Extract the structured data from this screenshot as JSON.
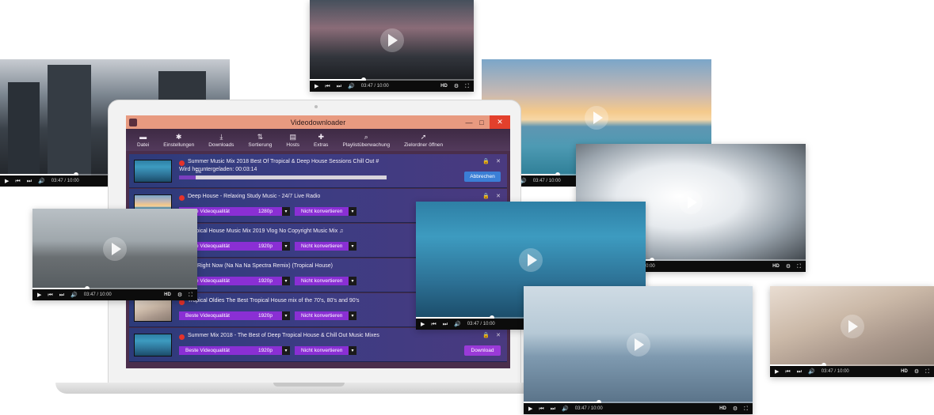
{
  "app": {
    "title": "Videodownloader",
    "window_buttons": {
      "minimize": "—",
      "maximize": "□",
      "close": "✕"
    },
    "toolbar": [
      {
        "label": "Datei",
        "icon": "folder-icon",
        "glyph": "▬"
      },
      {
        "label": "Einstellungen",
        "icon": "gear-icon",
        "glyph": "✱"
      },
      {
        "label": "Downloads",
        "icon": "download-icon",
        "glyph": "⤓"
      },
      {
        "label": "Sortierung",
        "icon": "sort-icon",
        "glyph": "⇅"
      },
      {
        "label": "Hosts",
        "icon": "hosts-icon",
        "glyph": "▤"
      },
      {
        "label": "Extras",
        "icon": "extras-icon",
        "glyph": "✚"
      },
      {
        "label": "Playlistüberwachung",
        "icon": "search-icon",
        "glyph": "⌕"
      },
      {
        "label": "Zielordner öffnen",
        "icon": "open-folder-icon",
        "glyph": "➚"
      }
    ],
    "rows": [
      {
        "title": "Summer Music Mix 2018 Best Of Tropical & Deep House Sessions Chill Out #",
        "status": "Wird heruntergeladen: 00:03:14",
        "progress_label": "8%",
        "progress": 0.08,
        "action": "Abbrechen"
      },
      {
        "title": "Deep House - Relaxing Study Music - 24/7 Live Radio",
        "quality": "Beste Videoqualität",
        "resolution": "1280p",
        "convert": "Nicht konvertieren"
      },
      {
        "title": "Tropical House Music Mix 2019 Vlog No Copyright Music Mix ♫",
        "quality": "Beste Videoqualität",
        "resolution": "1920p",
        "convert": "Nicht konvertieren"
      },
      {
        "title": "... - Right Now (Na Na Na Spectra Remix) (Tropical House)",
        "quality": "Beste Videoqualität",
        "resolution": "1920p",
        "convert": "Nicht konvertieren"
      },
      {
        "title": "Tropical Oldies The Best Tropical House mix of the 70's, 80's and 90's",
        "quality": "Beste Videoqualität",
        "resolution": "1920p",
        "convert": "Nicht konvertieren"
      },
      {
        "title": "Summer Mix 2018 - The Best of Deep Tropical House & Chill Out Music Mixes",
        "quality": "Beste Videoqualität",
        "resolution": "1920p",
        "convert": "Nicht konvertieren",
        "action": "Download"
      }
    ],
    "row_controls": {
      "lock": "🔒",
      "close": "✕"
    }
  },
  "player": {
    "time": "03:47 / 10:00",
    "hd": "HD",
    "controls": {
      "play": "▶",
      "prev": "⏮",
      "next": "⏭",
      "volume": "🔊",
      "settings": "⚙",
      "fullscreen": "⛶"
    }
  },
  "colors": {
    "accent": "#8a2fd4",
    "titlebar": "#e89a80",
    "close": "#e3402c",
    "abort": "#3b7fd6"
  }
}
